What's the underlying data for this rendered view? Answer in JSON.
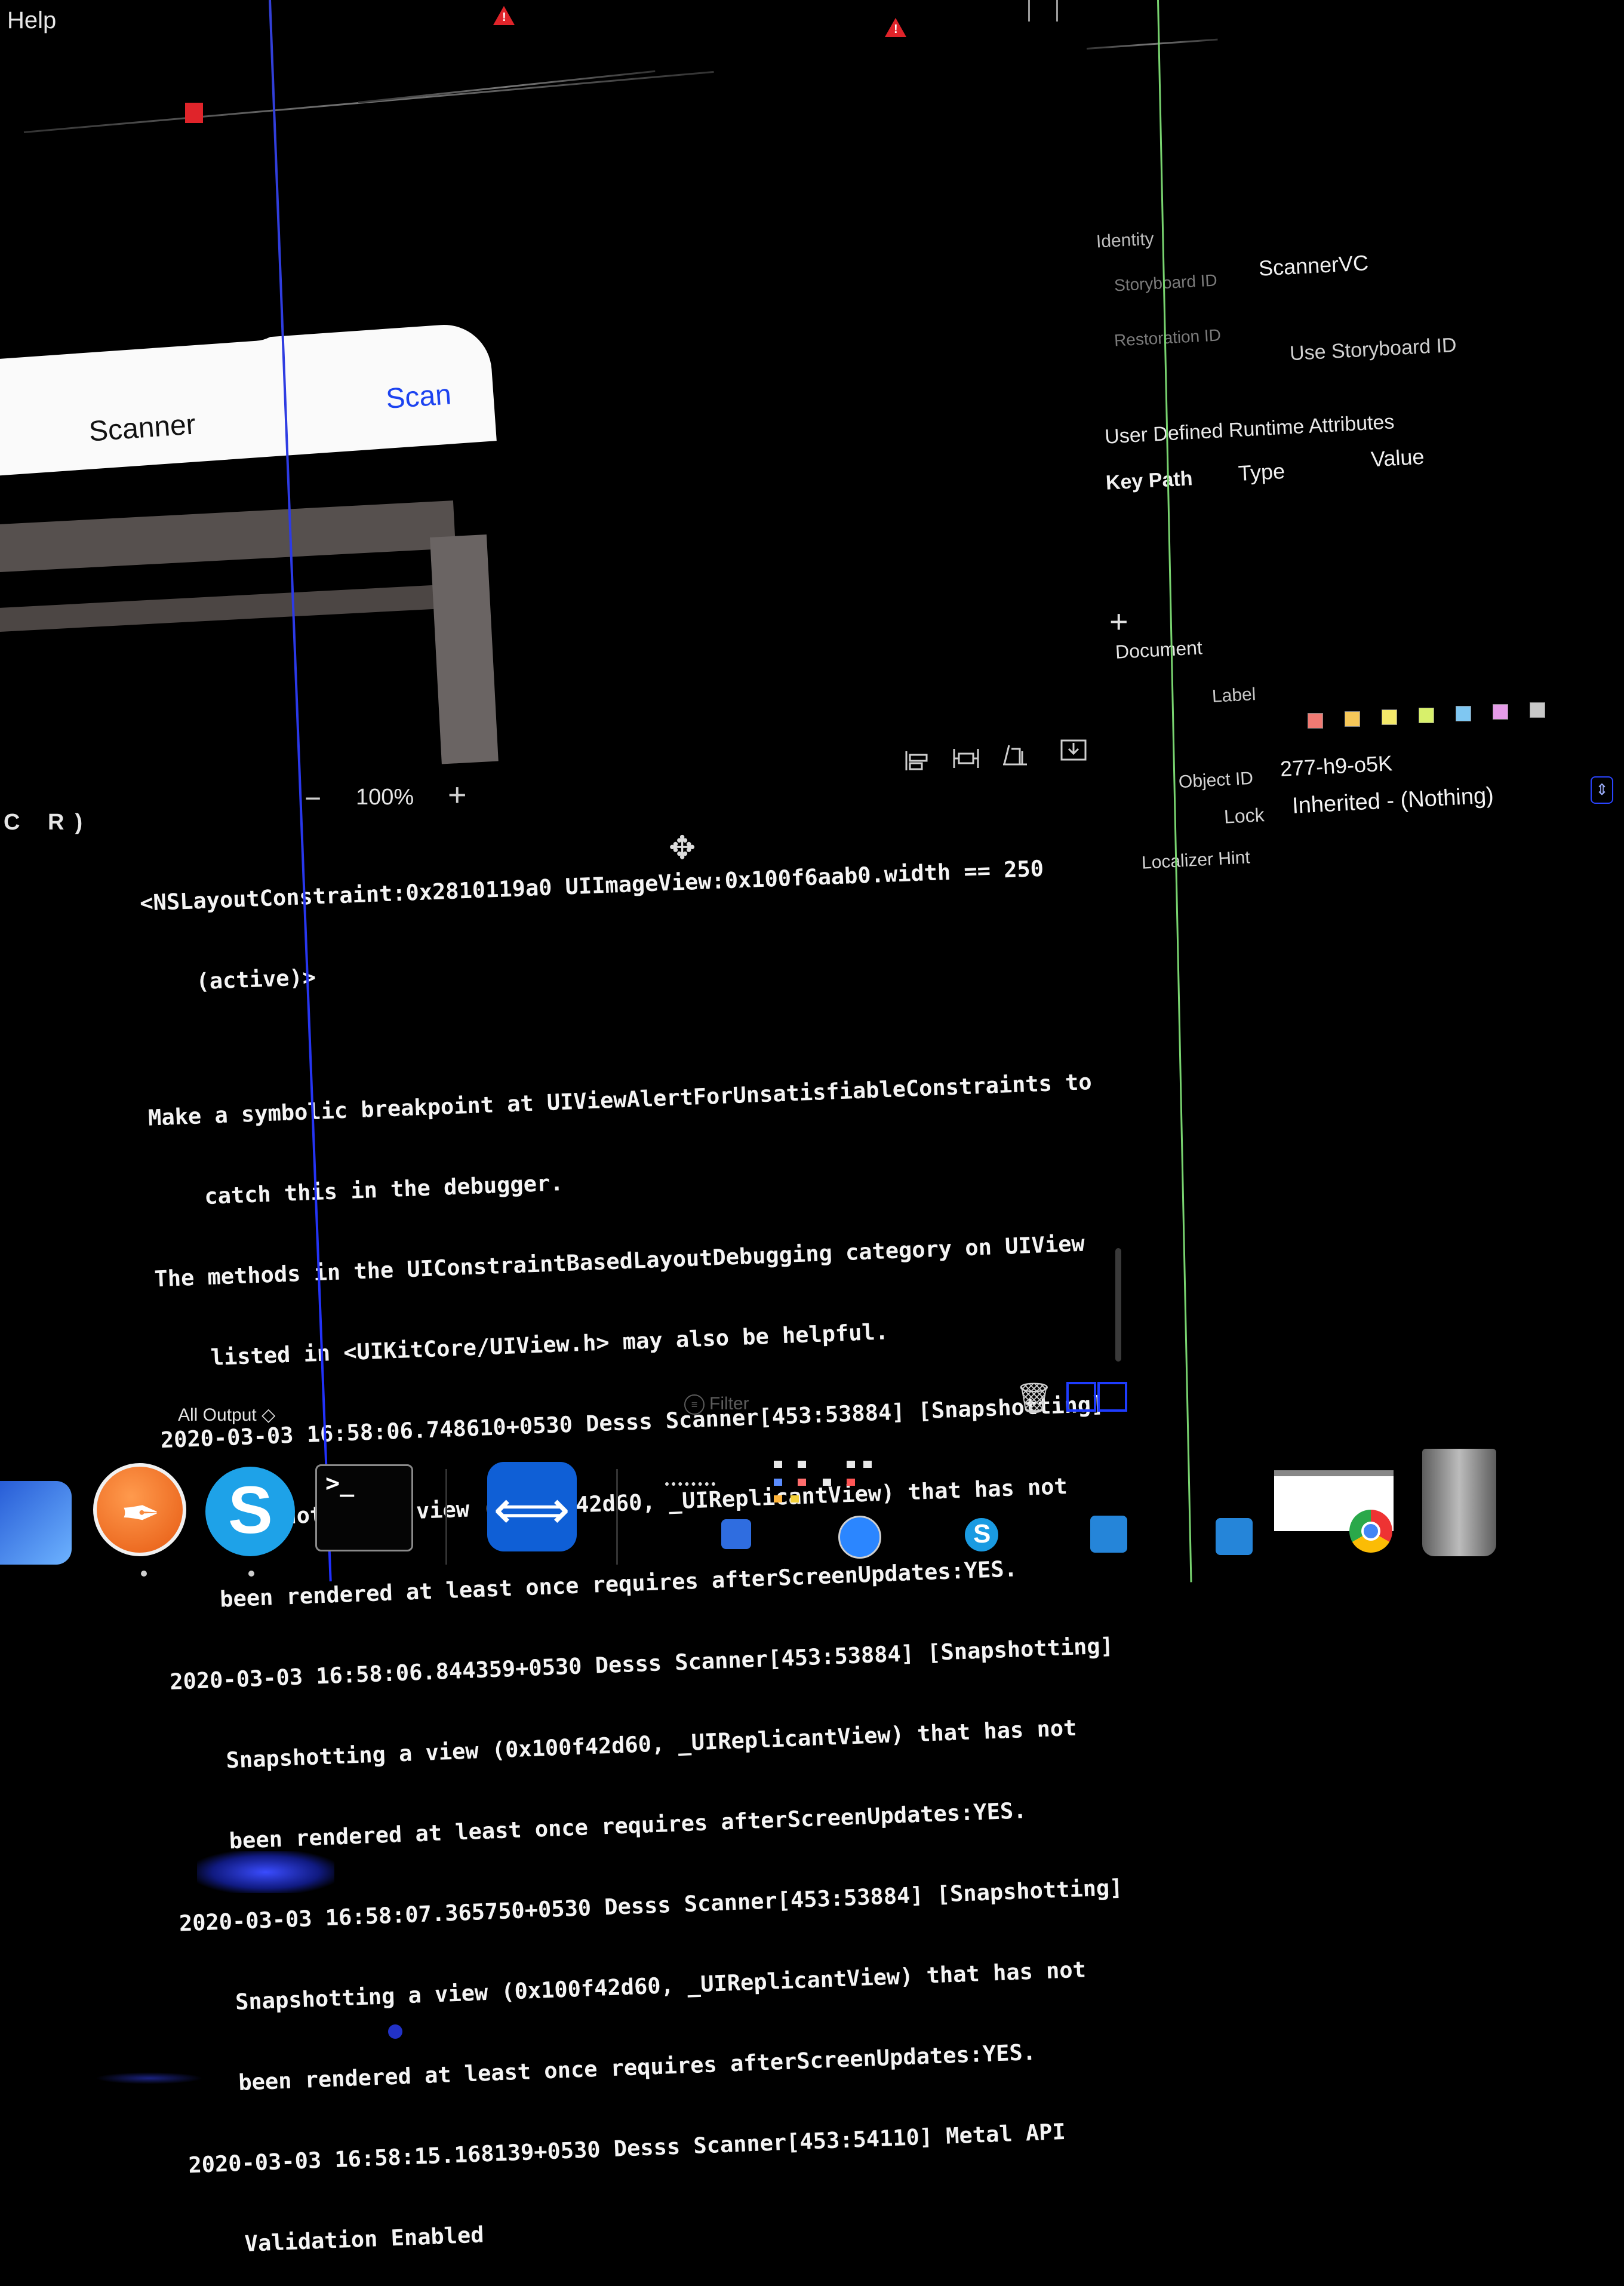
{
  "menu": {
    "help": "Help"
  },
  "storyboard": {
    "nav_title": "Scanner",
    "nav_button": "Scan",
    "zoom_level": "100%",
    "zoom_out_symbol": "−",
    "zoom_in_symbol": "+",
    "shortcut_hint": "C R)"
  },
  "console": {
    "lines": [
      "<NSLayoutConstraint:0x2810119a0 UIImageView:0x100f6aab0.width == 250",
      "    (active)>",
      "",
      "Make a symbolic breakpoint at UIViewAlertForUnsatisfiableConstraints to",
      "    catch this in the debugger.",
      "The methods in the UIConstraintBasedLayoutDebugging category on UIView",
      "    listed in <UIKitCore/UIView.h> may also be helpful.",
      "2020-03-03 16:58:06.748610+0530 Desss Scanner[453:53884] [Snapshotting]",
      "    Snapshotting a view (0x100f42d60, _UIReplicantView) that has not",
      "    been rendered at least once requires afterScreenUpdates:YES.",
      "2020-03-03 16:58:06.844359+0530 Desss Scanner[453:53884] [Snapshotting]",
      "    Snapshotting a view (0x100f42d60, _UIReplicantView) that has not",
      "    been rendered at least once requires afterScreenUpdates:YES.",
      "2020-03-03 16:58:07.365750+0530 Desss Scanner[453:53884] [Snapshotting]",
      "    Snapshotting a view (0x100f42d60, _UIReplicantView) that has not",
      "    been rendered at least once requires afterScreenUpdates:YES.",
      "2020-03-03 16:58:15.168139+0530 Desss Scanner[453:54110] Metal API",
      "    Validation Enabled"
    ],
    "output_selector": "All Output ◇",
    "filter_placeholder": "Filter"
  },
  "inspector": {
    "identity_header": "Identity",
    "storyboard_id_label": "Storyboard ID",
    "storyboard_id_value": "ScannerVC",
    "restoration_id_label": "Restoration ID",
    "use_storyboard_id": "Use Storyboard ID",
    "udra_header": "User Defined Runtime Attributes",
    "col_key_path": "Key Path",
    "col_type": "Type",
    "col_value": "Value",
    "add_symbol": "+",
    "document_header": "Document",
    "label_label": "Label",
    "label_colors": [
      "#f07a73",
      "#f6c85a",
      "#f4e96a",
      "#d8f06b",
      "#7fc7f2",
      "#e59ce8",
      "#c8c8c8"
    ],
    "object_id_label": "Object ID",
    "object_id_value": "277-h9-o5K",
    "lock_label": "Lock",
    "lock_value": "Inherited - (Nothing)",
    "localizer_hint_label": "Localizer Hint"
  },
  "dock": {
    "terminal_prompt": ">_",
    "skype_letter": "S",
    "teamviewer_glyph": "⟺"
  },
  "icons": {
    "warning": "warning-icon",
    "move": "move-icon",
    "trash": "trash-icon",
    "filter": "filter-icon"
  },
  "colors": {
    "warning": "#e0242a",
    "accent_blue": "#1c43f0",
    "console_text": "#f4f4f4",
    "background": "#000000"
  }
}
